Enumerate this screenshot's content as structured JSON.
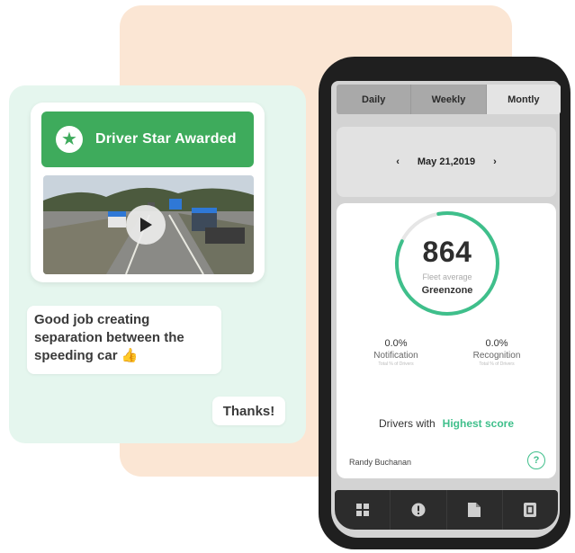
{
  "award": {
    "title": "Driver Star Awarded",
    "icon": "star-icon"
  },
  "video": {
    "play_icon": "play-icon"
  },
  "chat": {
    "message": "Good job creating separation between the speeding car 👍",
    "reply": "Thanks!"
  },
  "tabs": [
    {
      "label": "Daily"
    },
    {
      "label": "Weekly"
    },
    {
      "label": "Montly"
    }
  ],
  "date_nav": {
    "prev": "‹",
    "date": "May 21,2019",
    "next": "›"
  },
  "score": {
    "value": "864",
    "caption": "Fleet average",
    "zone": "Greenzone",
    "ring_color": "#3fbf8b",
    "ring_fill_fraction": 0.85
  },
  "stats": [
    {
      "value": "0.0%",
      "label": "Notification",
      "sub": "Total % of Drivers"
    },
    {
      "value": "0.0%",
      "label": "Recognition",
      "sub": "Total % of Drivers"
    }
  ],
  "drivers": {
    "prefix": "Drivers with",
    "highlight": "Highest score",
    "name": "Randy Buchanan"
  },
  "help_icon": "help-icon",
  "bottom_nav": [
    {
      "icon": "grid-icon"
    },
    {
      "icon": "alert-icon"
    },
    {
      "icon": "document-icon"
    },
    {
      "icon": "report-icon"
    }
  ],
  "colors": {
    "accent": "#3fbf8b",
    "award_green": "#3eab5c",
    "peach": "#fbe6d4",
    "mint": "#e5f6ee"
  }
}
